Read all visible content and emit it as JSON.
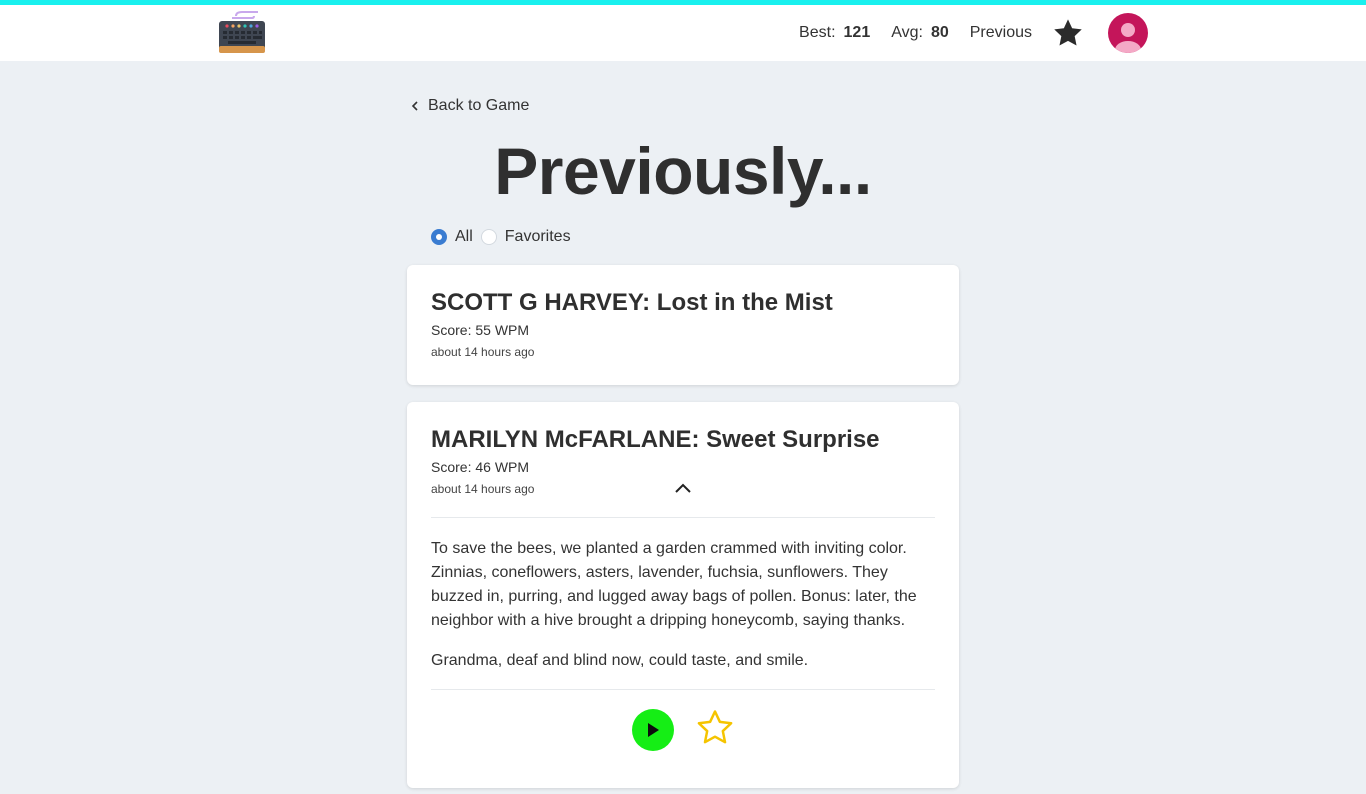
{
  "colors": {
    "accent_bar": "#19f0ee",
    "radio_selected": "#3a7cd1",
    "play_button": "#15ee15",
    "favorite_star": "#f5c400",
    "avatar": "#c4155a"
  },
  "header": {
    "logo_icon": "keyboard-icon",
    "best_label": "Best:",
    "best_value": "121",
    "avg_label": "Avg:",
    "avg_value": "80",
    "previous_link": "Previous",
    "favorites_icon": "star-icon",
    "avatar_icon": "user-avatar-icon"
  },
  "back_link": "Back to Game",
  "page_title": "Previously...",
  "filter": {
    "options": [
      "All",
      "Favorites"
    ],
    "selected": "All"
  },
  "entries": [
    {
      "title": "SCOTT G HARVEY: Lost in the Mist",
      "score": "Score: 55 WPM",
      "time": "about 14 hours ago",
      "expanded": false
    },
    {
      "title": "MARILYN McFARLANE: Sweet Surprise",
      "score": "Score: 46 WPM",
      "time": "about 14 hours ago",
      "expanded": true,
      "paragraphs": [
        "To save the bees, we planted a garden crammed with inviting color. Zinnias, coneflowers, asters, lavender, fuchsia, sunflowers. They buzzed in, purring, and lugged away bags of pollen. Bonus: later, the neighbor with a hive brought a dripping honeycomb, saying thanks.",
        "Grandma, deaf and blind now, could taste, and smile."
      ],
      "favorited": false
    }
  ]
}
